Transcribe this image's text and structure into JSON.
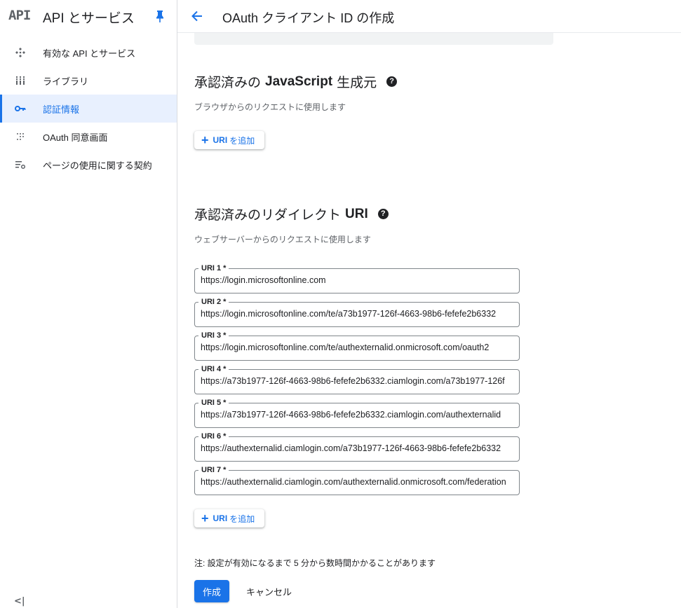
{
  "sidebar": {
    "logo": "API",
    "title": "API とサービス",
    "items": [
      {
        "label": "有効な API とサービス",
        "icon": "enabled-apis-icon"
      },
      {
        "label": "ライブラリ",
        "icon": "library-icon"
      },
      {
        "label": "認証情報",
        "icon": "key-icon",
        "active": true
      },
      {
        "label": "OAuth 同意画面",
        "icon": "consent-screen-icon"
      },
      {
        "label": "ページの使用に関する契約",
        "icon": "page-agreement-icon"
      }
    ],
    "collapse": "<|"
  },
  "header": {
    "title": "OAuth クライアント ID の作成"
  },
  "js_origins": {
    "title_pre": "承認済みの",
    "title_bold": "JavaScript",
    "title_post": "生成元",
    "help": "?",
    "description": "ブラウザからのリクエストに使用します",
    "add_button": {
      "uri": "URI",
      "rest": "を追加"
    }
  },
  "redirect_uris": {
    "title_pre": "承認済みのリダイレクト",
    "title_bold": "URI",
    "help": "?",
    "description": "ウェブサーバーからのリクエストに使用します",
    "fields": [
      {
        "label": "URI 1 *",
        "value": "https://login.microsoftonline.com"
      },
      {
        "label": "URI 2 *",
        "value": "https://login.microsoftonline.com/te/a73b1977-126f-4663-98b6-fefefe2b6332"
      },
      {
        "label": "URI 3 *",
        "value": "https://login.microsoftonline.com/te/authexternalid.onmicrosoft.com/oauth2"
      },
      {
        "label": "URI 4 *",
        "value": "https://a73b1977-126f-4663-98b6-fefefe2b6332.ciamlogin.com/a73b1977-126f"
      },
      {
        "label": "URI 5 *",
        "value": "https://a73b1977-126f-4663-98b6-fefefe2b6332.ciamlogin.com/authexternalid"
      },
      {
        "label": "URI 6 *",
        "value": "https://authexternalid.ciamlogin.com/a73b1977-126f-4663-98b6-fefefe2b6332"
      },
      {
        "label": "URI 7 *",
        "value": "https://authexternalid.ciamlogin.com/authexternalid.onmicrosoft.com/federation"
      }
    ],
    "add_button": {
      "uri": "URI",
      "rest": "を追加"
    }
  },
  "footer": {
    "note": "注: 設定が有効になるまで 5 分から数時間かかることがあります",
    "create": "作成",
    "cancel": "キャンセル"
  },
  "colors": {
    "accent": "#1a73e8",
    "active_bg": "#e8f0fe"
  }
}
